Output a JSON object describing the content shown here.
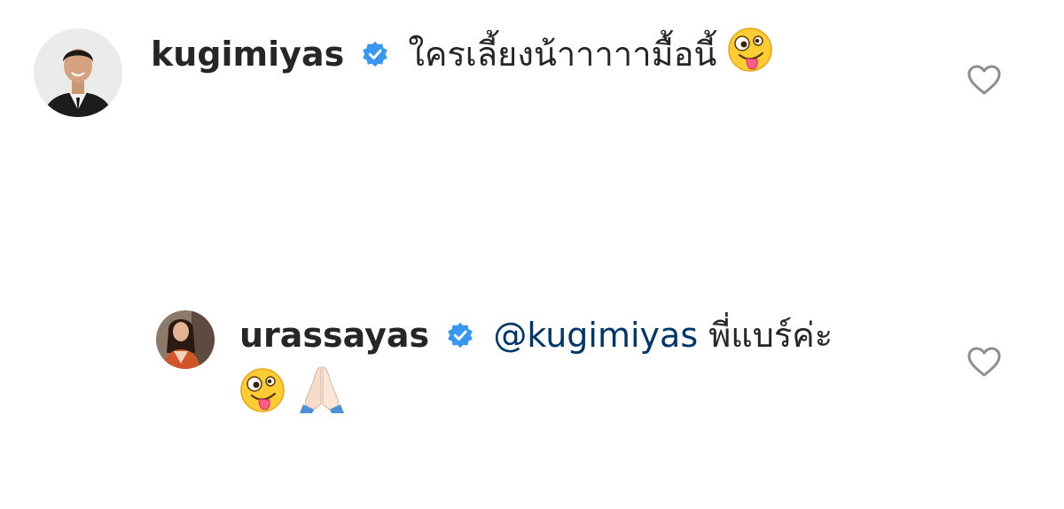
{
  "comments": [
    {
      "username": "kugimiyas",
      "verified": true,
      "text": "ใครเลี้ยงน้าาาาามื้อนี้",
      "emojis": [
        "zany-face"
      ],
      "like_icon": "heart-outline-icon"
    },
    {
      "username": "urassayas",
      "verified": true,
      "mention": "@kugimiyas",
      "text": "พี่แบร์ค่ะ",
      "emojis": [
        "zany-face",
        "folded-hands"
      ],
      "like_icon": "heart-outline-icon"
    }
  ],
  "colors": {
    "verified_badge": "#3897f0",
    "mention": "#00376b",
    "heart_outline": "#8e8e8e",
    "text": "#262626"
  }
}
